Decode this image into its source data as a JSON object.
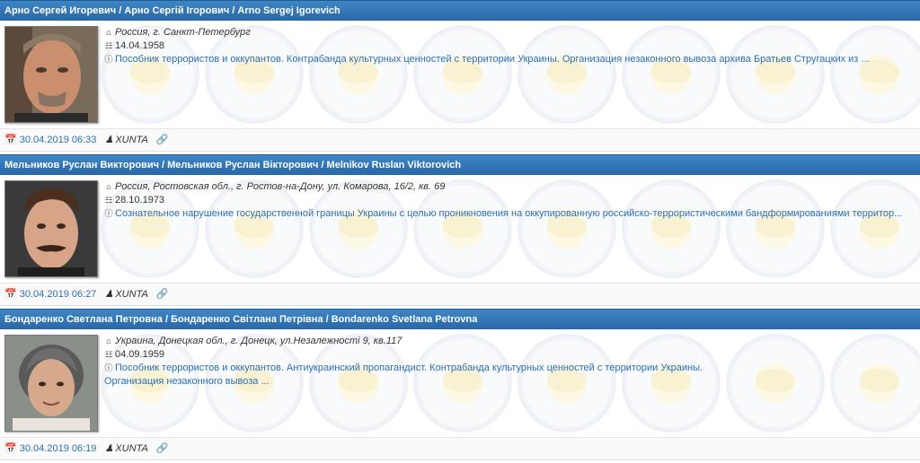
{
  "cards": [
    {
      "title": "Арно Сергей Игоревич / Арно Сергій Ігорович / Arno Sergej Igorevich",
      "location": "Россия, г. Санкт-Петербург",
      "birthdate": "14.04.1958",
      "charge_line1": "Пособник террористов и оккупантов. Контрабанда культурных ценностей с территории Украины. Организация незаконного вывоза архива Братьев Стругацких из ...",
      "charge_line2": "",
      "date": "30.04.2019 06:33",
      "user": "XUNTA"
    },
    {
      "title": "Мельников Руслан Викторович / Мельников Руслан Вікторович / Melnikov Ruslan Viktorovich",
      "location": "Россия, Ростовская обл., г. Ростов-на-Дону, ул. Комарова, 16/2, кв. 69",
      "birthdate": "28.10.1973",
      "charge_line1": "Сознательное нарушение государственной границы Украины с целью проникновения на оккупированную российско-террористическими бандформированиями территор...",
      "charge_line2": "",
      "date": "30.04.2019 06:27",
      "user": "XUNTA"
    },
    {
      "title": "Бондаренко Светлана Петровна / Бондаренко Світлана Петрівна / Bondarenko Svetlana Petrovna",
      "location": "Украина, Донецкая обл., г. Донецк, ул.Незалежності 9, кв.117",
      "birthdate": "04.09.1959",
      "charge_line1": "Пособник террористов и оккупантов. Антиукраинский пропагандист. Контрабанда культурных ценностей с территории Украины.",
      "charge_line2": "Организация незаконного вывоза ...",
      "date": "30.04.2019 06:19",
      "user": "XUNTA"
    }
  ],
  "icons": {
    "home": "home-icon",
    "birthday": "birthday-cake-icon",
    "info": "info-circle-icon",
    "calendar": "calendar-icon",
    "user": "user-icon",
    "link": "link-icon"
  },
  "colors": {
    "header_bg": "#2f74b5",
    "link_blue": "#2a6fb5",
    "footer_bg": "#fafafa"
  }
}
